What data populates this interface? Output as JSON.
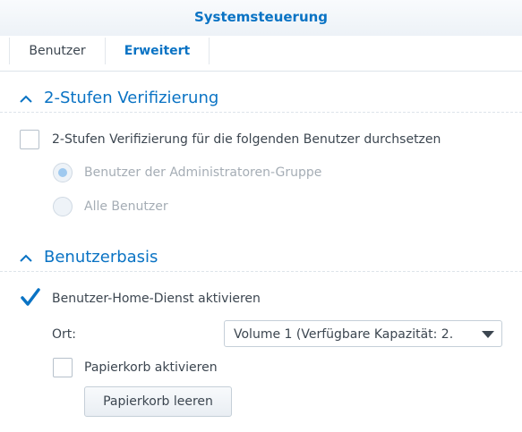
{
  "window": {
    "title": "Systemsteuerung"
  },
  "tabs": [
    {
      "label": "Benutzer",
      "active": false
    },
    {
      "label": "Erweitert",
      "active": true
    }
  ],
  "two_factor": {
    "title": "2-Stufen Verifizierung",
    "enforce_label": "2-Stufen Verifizierung für die folgenden Benutzer durchsetzen",
    "enforce_checked": false,
    "options": [
      {
        "label": "Benutzer der Administratoren-Gruppe",
        "selected": true,
        "disabled": true
      },
      {
        "label": "Alle Benutzer",
        "selected": false,
        "disabled": true
      }
    ]
  },
  "user_home": {
    "title": "Benutzerbasis",
    "enable_label": "Benutzer-Home-Dienst aktivieren",
    "enable_checked": true,
    "location_label": "Ort:",
    "location_value": "Volume 1 (Verfügbare Kapazität: 2.",
    "recycle_label": "Papierkorb aktivieren",
    "recycle_checked": false,
    "empty_recycle_button": "Papierkorb leeren"
  },
  "colors": {
    "accent": "#0a73c4",
    "text": "#3c4650",
    "disabled_text": "#a5adb5"
  },
  "icons": {
    "section_toggle": "chevron-up-icon",
    "checkmark": "checkmark-icon",
    "dropdown": "caret-down-icon"
  }
}
